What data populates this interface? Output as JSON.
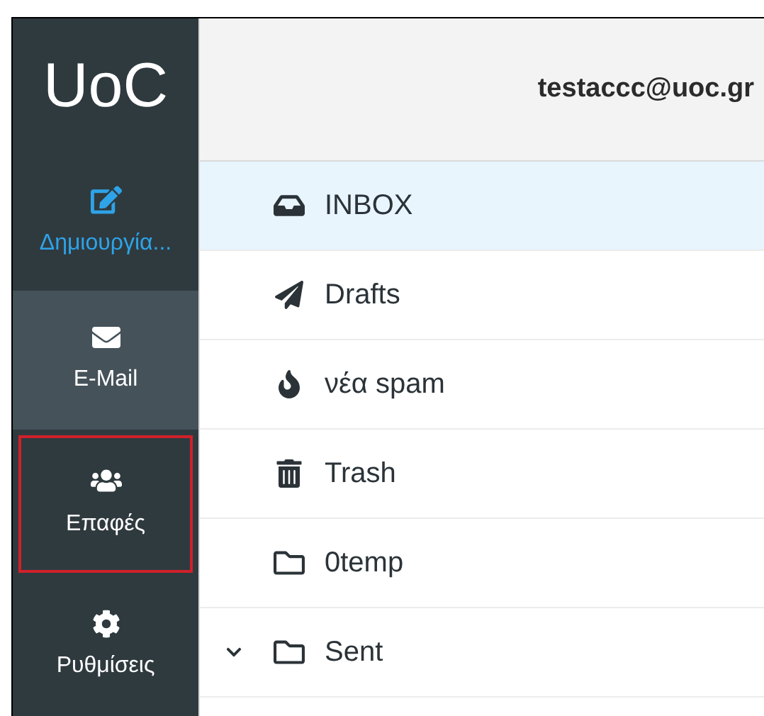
{
  "sidebar": {
    "logo": "UoC",
    "items": [
      {
        "kind": "compose",
        "label": "Δημιουργία...",
        "selected": false,
        "focused": false
      },
      {
        "kind": "mail",
        "label": "E-Mail",
        "selected": true,
        "focused": false
      },
      {
        "kind": "contacts",
        "label": "Επαφές",
        "selected": false,
        "focused": true
      },
      {
        "kind": "settings",
        "label": "Ρυθμίσεις",
        "selected": false,
        "focused": false
      }
    ]
  },
  "header": {
    "account": "testaccc@uoc.gr"
  },
  "folders": [
    {
      "kind": "inbox",
      "name": "INBOX",
      "selected": true
    },
    {
      "kind": "drafts",
      "name": "Drafts",
      "selected": false
    },
    {
      "kind": "spam",
      "name": "νέα spam",
      "selected": false
    },
    {
      "kind": "trash",
      "name": "Trash",
      "selected": false
    },
    {
      "kind": "folder",
      "name": "0temp",
      "selected": false
    },
    {
      "kind": "folder",
      "name": "Sent",
      "selected": false,
      "expanded": true
    }
  ]
}
